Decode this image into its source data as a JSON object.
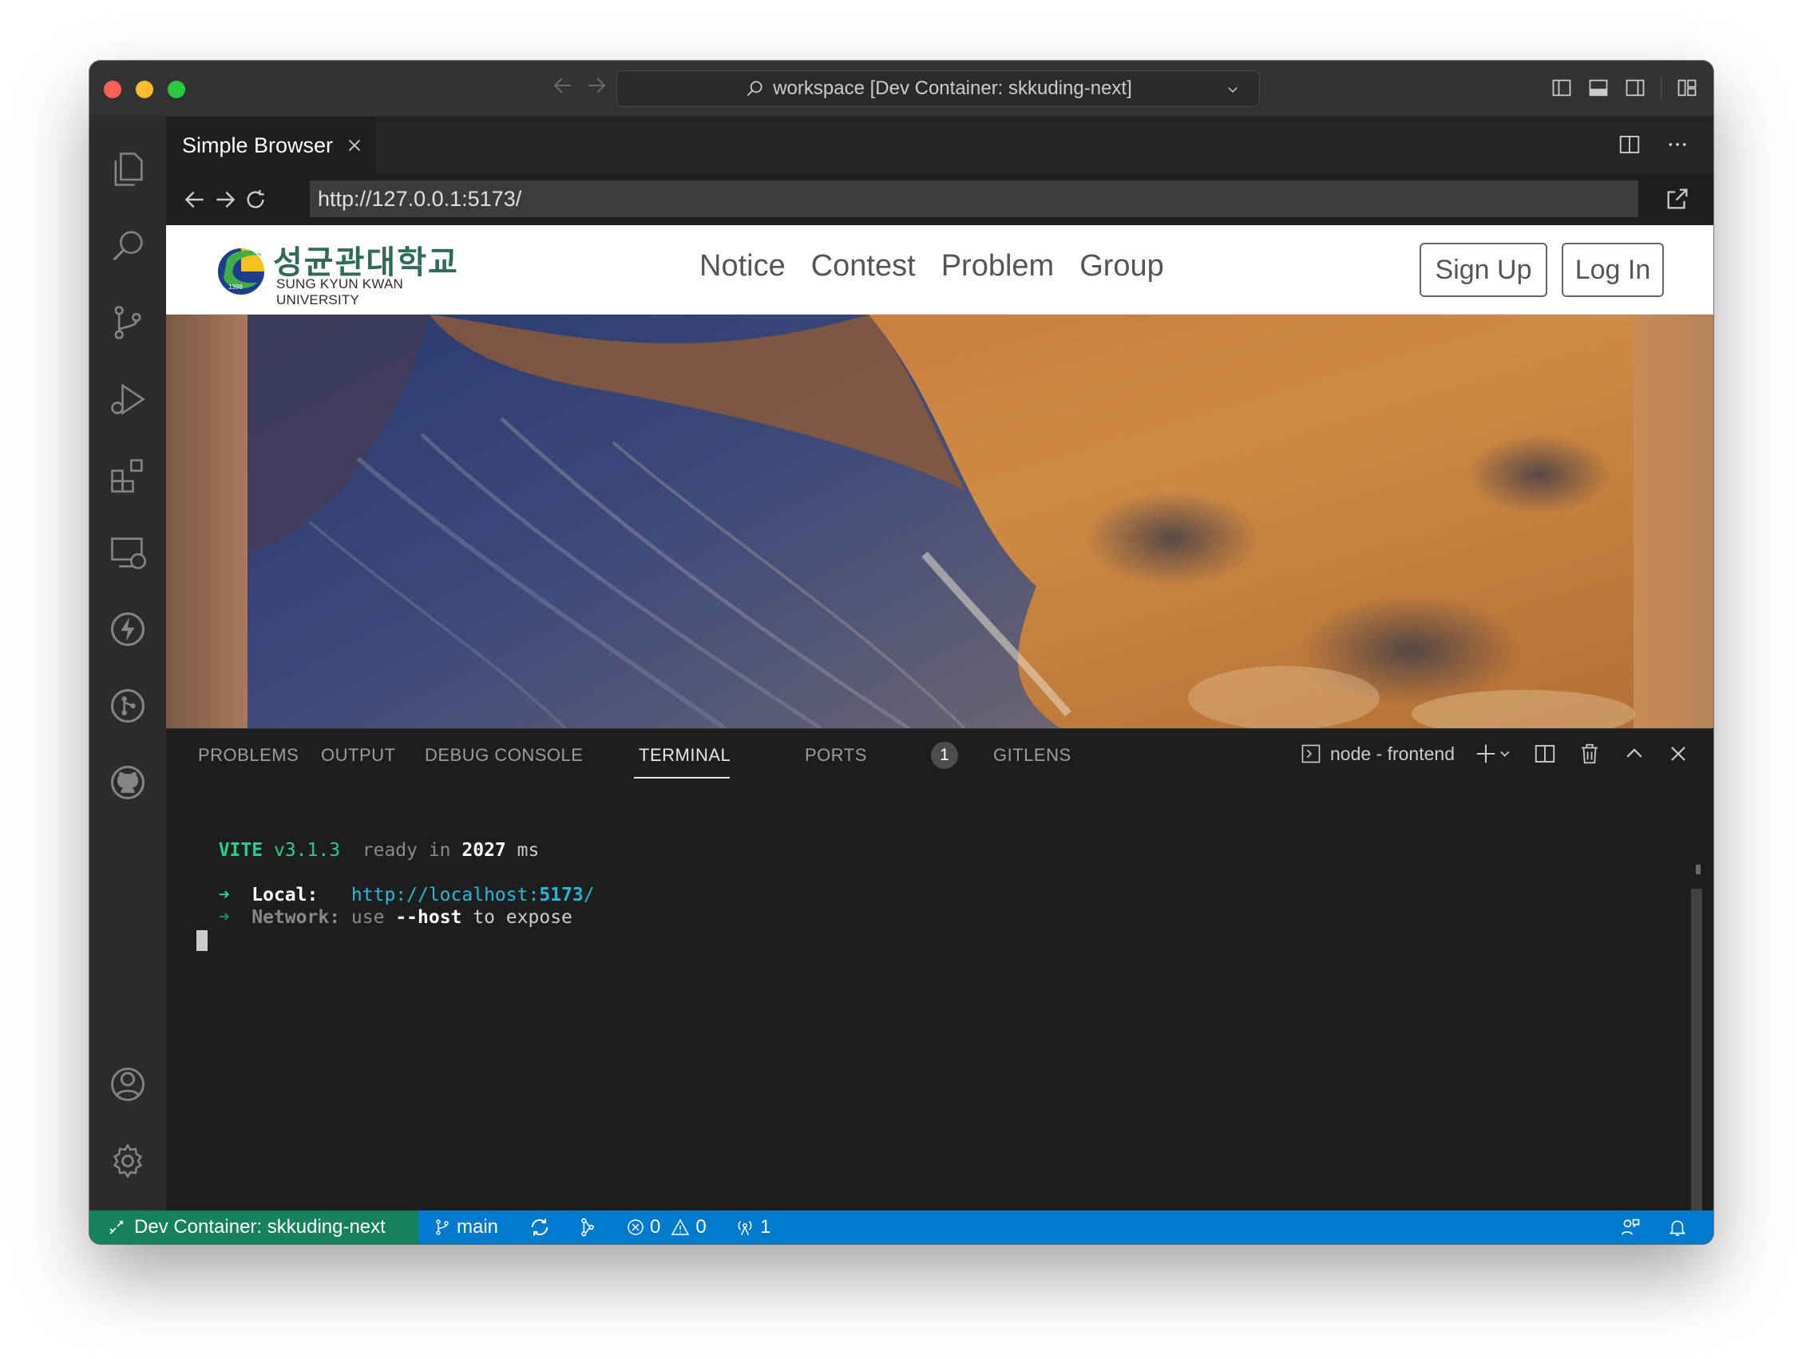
{
  "titlebar": {
    "command_center": "workspace [Dev Container: skkuding-next]",
    "icons": [
      "back-arrow-icon",
      "forward-arrow-icon",
      "search-icon",
      "chevron-down-icon",
      "toggle-sidebar-icon",
      "toggle-panel-icon",
      "toggle-secondary-sidebar-icon",
      "customize-layout-icon"
    ]
  },
  "activity_bar": {
    "items": [
      "explorer-icon",
      "search-icon",
      "source-control-icon",
      "run-debug-icon",
      "extensions-icon",
      "remote-explorer-icon",
      "thunder-client-icon",
      "gitlens-icon",
      "github-icon"
    ],
    "bottom": [
      "accounts-icon",
      "settings-gear-icon"
    ]
  },
  "editor": {
    "tab_label": "Simple Browser",
    "url": "http://127.0.0.1:5173/"
  },
  "site": {
    "logo_korean": "성균관대학교",
    "logo_english": "SUNG KYUN KWAN UNIVERSITY",
    "logo_year": "1398",
    "nav": [
      "Notice",
      "Contest",
      "Problem",
      "Group"
    ],
    "signup_label": "Sign Up",
    "login_label": "Log In"
  },
  "panel": {
    "tabs": [
      "PROBLEMS",
      "OUTPUT",
      "DEBUG CONSOLE",
      "TERMINAL",
      "PORTS",
      "GITLENS"
    ],
    "active_tab": "TERMINAL",
    "ports_badge": "1",
    "terminal_name": "node - frontend"
  },
  "terminal": {
    "vite": "VITE",
    "version": "v3.1.3",
    "ready": "ready in",
    "ms_value": "2027",
    "ms_unit": "ms",
    "arrow": "➜",
    "local_label": "Local:",
    "local_url_prefix": "http://localhost:",
    "local_port": "5173",
    "local_url_suffix": "/",
    "network_label": "Network:",
    "network_use": "use",
    "network_flag": "--host",
    "network_rest": "to expose"
  },
  "statusbar": {
    "remote": "Dev Container: skkuding-next",
    "branch": "main",
    "errors": "0",
    "warnings": "0",
    "ports": "1"
  },
  "colors": {
    "statusbar": "#007acc",
    "remote": "#16825d",
    "vite_green": "#23d18b",
    "link_cyan": "#29b8db"
  }
}
